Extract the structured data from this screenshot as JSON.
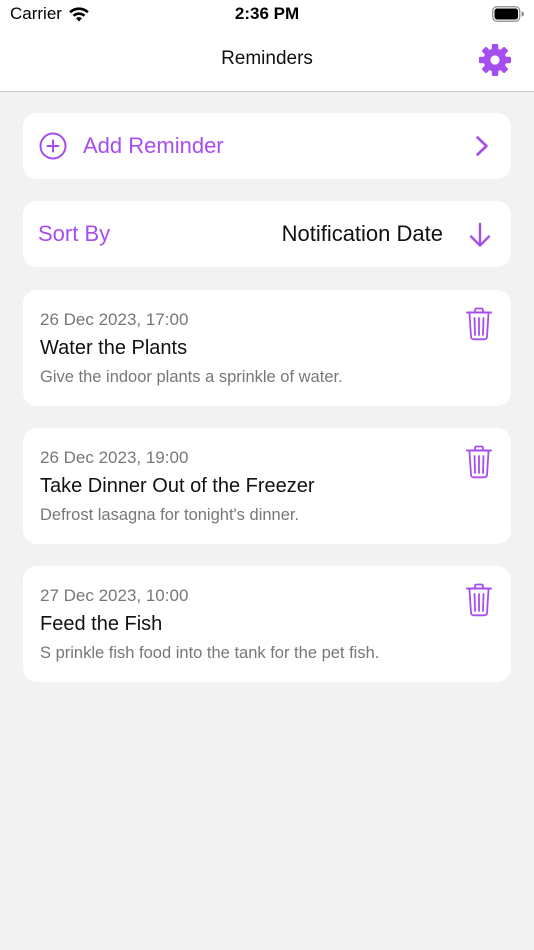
{
  "status_bar": {
    "carrier": "Carrier",
    "time": "2:36 PM"
  },
  "nav": {
    "title": "Reminders",
    "settings_icon": "gear-icon"
  },
  "add_reminder": {
    "label": "Add Reminder",
    "icon": "plus-circle-icon"
  },
  "sort": {
    "label": "Sort By",
    "value": "Notification Date",
    "direction_icon": "arrow-down-icon"
  },
  "reminders": [
    {
      "date": "26 Dec 2023, 17:00",
      "title": "Water the Plants",
      "description": "Give the indoor plants a sprinkle of water."
    },
    {
      "date": "26 Dec 2023, 19:00",
      "title": "Take Dinner Out of the Freezer",
      "description": "Defrost lasagna for tonight's dinner."
    },
    {
      "date": "27 Dec 2023, 10:00",
      "title": "Feed the Fish",
      "description": "S prinkle fish food into the tank for the pet fish."
    }
  ],
  "colors": {
    "accent": "#a64df0",
    "background": "#f2f2f2",
    "card": "#ffffff",
    "secondary_text": "#777777"
  }
}
